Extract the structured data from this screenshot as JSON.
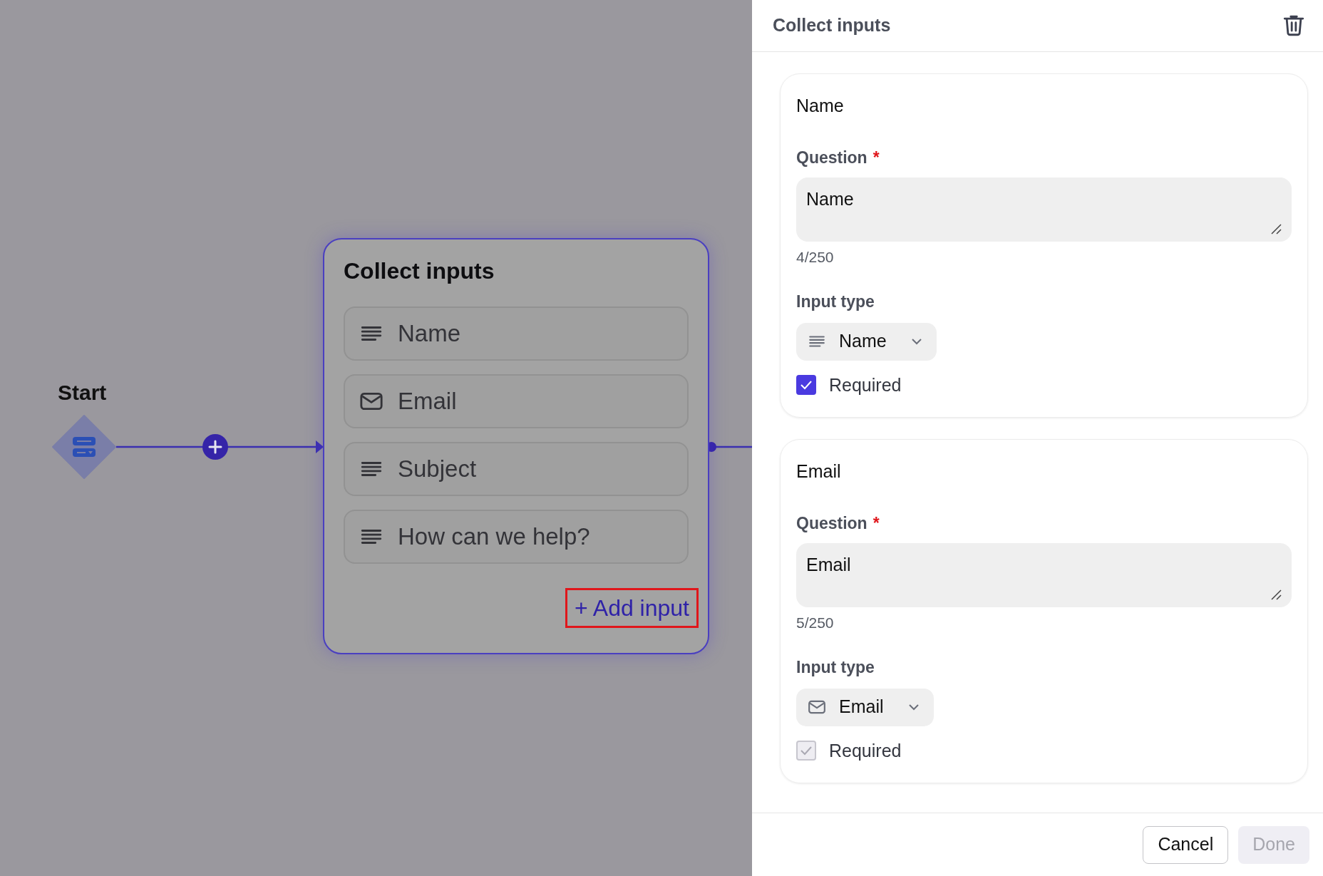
{
  "canvas": {
    "start": {
      "label": "Start"
    },
    "node": {
      "title": "Collect inputs",
      "items": [
        {
          "kind": "text",
          "label": "Name"
        },
        {
          "kind": "email",
          "label": "Email"
        },
        {
          "kind": "text",
          "label": "Subject"
        },
        {
          "kind": "text",
          "label": "How can we help?"
        }
      ],
      "add_button": "+ Add input"
    }
  },
  "panel": {
    "title": "Collect inputs",
    "inputs": [
      {
        "title": "Name",
        "question_label": "Question",
        "required_mark": "*",
        "question": "Name",
        "count": "4/250",
        "type_label": "Input type",
        "type": {
          "kind": "text",
          "label": "Name"
        },
        "required": {
          "label": "Required",
          "checked": true,
          "disabled": false
        }
      },
      {
        "title": "Email",
        "question_label": "Question",
        "required_mark": "*",
        "question": "Email",
        "count": "5/250",
        "type_label": "Input type",
        "type": {
          "kind": "email",
          "label": "Email"
        },
        "required": {
          "label": "Required",
          "checked": true,
          "disabled": true
        }
      }
    ],
    "buttons": [
      {
        "label": "Cancel",
        "disabled": false
      },
      {
        "label": "Done",
        "disabled": true
      }
    ]
  }
}
